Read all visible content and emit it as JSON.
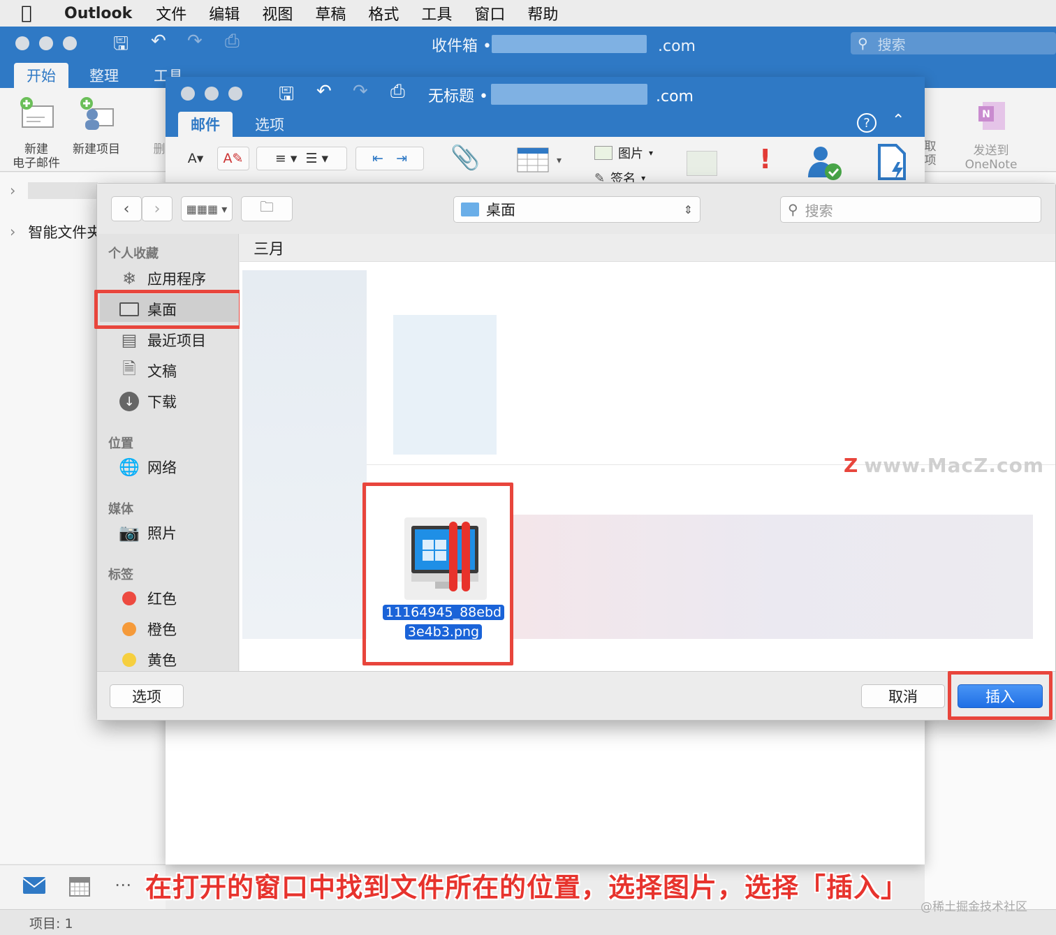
{
  "menubar": {
    "app": "Outlook",
    "items": [
      "文件",
      "编辑",
      "视图",
      "草稿",
      "格式",
      "工具",
      "窗口",
      "帮助"
    ]
  },
  "main_window": {
    "title_prefix": "收件箱 •",
    "title_suffix": ".com",
    "search_placeholder": "搜索",
    "tabs": [
      "开始",
      "整理",
      "工具"
    ],
    "ribbon": {
      "new_email": "新建\n电子邮件",
      "new_item": "新建项目",
      "delete_partial": "删",
      "send_onenote": "发送到\nOneNote",
      "partial_right": "取\n项"
    },
    "left_pane": {
      "smart_folder": "智能文件夹"
    },
    "status": "项目: 1"
  },
  "compose_window": {
    "title_prefix": "无标题 •",
    "title_suffix": ".com",
    "tabs": [
      "邮件",
      "选项"
    ],
    "help": "?",
    "ribbon": {
      "picture": "图片",
      "signature": "签名"
    }
  },
  "file_dialog": {
    "location": "桌面",
    "search_placeholder": "搜索",
    "group_header": "三月",
    "sidebar": {
      "favorites_header": "个人收藏",
      "favorites": [
        "应用程序",
        "桌面",
        "最近项目",
        "文稿",
        "下载"
      ],
      "locations_header": "位置",
      "locations": [
        "网络"
      ],
      "media_header": "媒体",
      "media": [
        "照片"
      ],
      "tags_header": "标签",
      "tags": [
        {
          "label": "红色",
          "color": "#ed4a40"
        },
        {
          "label": "橙色",
          "color": "#f59a3a"
        },
        {
          "label": "黄色",
          "color": "#f6cf3f"
        }
      ],
      "selected": "桌面"
    },
    "selected_file": {
      "name_line1": "11164945_88ebd",
      "name_line2": "3e4b3.png"
    },
    "buttons": {
      "options": "选项",
      "cancel": "取消",
      "insert": "插入"
    }
  },
  "overlay": {
    "watermark": "www.MacZ.com",
    "watermark_letter": "Z",
    "caption": "在打开的窗口中找到文件所在的位置，选择图片，选择「插入」",
    "credit": "@稀土掘金技术社区"
  },
  "colors": {
    "outlook_blue": "#2f79c5",
    "highlight_red": "#e8453c",
    "primary_button": "#1f6fe5"
  }
}
